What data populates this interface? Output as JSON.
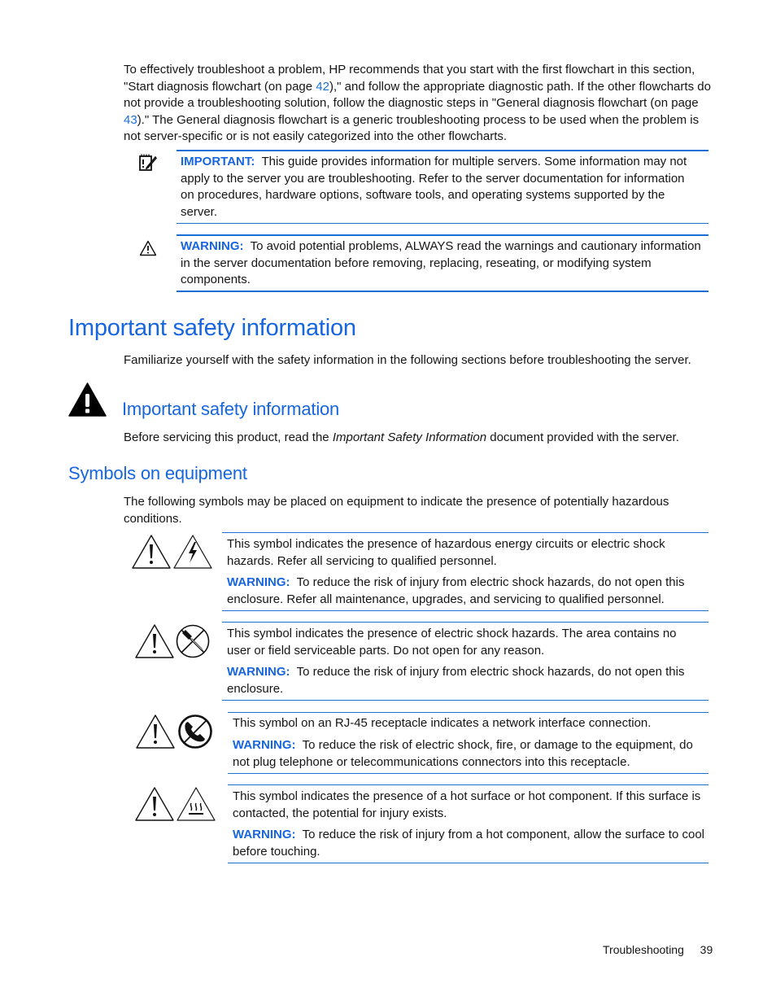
{
  "intro": {
    "text_1": "To effectively troubleshoot a problem, HP recommends that you start with the first flowchart in this section, \"Start diagnosis flowchart (on page ",
    "link_1": "42",
    "text_2": "),\" and follow the appropriate diagnostic path. If the other flowcharts do not provide a troubleshooting solution, follow the diagnostic steps in \"General diagnosis flowchart (on page ",
    "link_2": "43",
    "text_3": ").\" The General diagnosis flowchart is a generic troubleshooting process to be used when the problem is not server-specific or is not easily categorized into the other flowcharts."
  },
  "notes": [
    {
      "icon": "notepad-pencil-icon",
      "label": "IMPORTANT:",
      "text": "This guide provides information for multiple servers. Some information may not apply to the server you are troubleshooting. Refer to the server documentation for information on procedures, hardware options, software tools, and operating systems supported by the server."
    },
    {
      "icon": "warning-triangle-icon",
      "label": "WARNING:",
      "text": "To avoid potential problems, ALWAYS read the warnings and cautionary information in the server documentation before removing, replacing, reseating, or modifying system components."
    }
  ],
  "section": {
    "title": "Important safety information",
    "intro": "Familiarize yourself with the safety information in the following sections before troubleshooting the server."
  },
  "subsection_safety": {
    "icon": "solid-warning-triangle-icon",
    "title": "Important safety information",
    "text_before": "Before servicing this product, read the ",
    "text_italic": "Important Safety Information",
    "text_after": " document provided with the server."
  },
  "subsection_symbols": {
    "title": "Symbols on equipment",
    "intro": "The following symbols may be placed on equipment to indicate the presence of potentially hazardous conditions.",
    "items": [
      {
        "icons": [
          "exclamation-triangle-icon",
          "lightning-triangle-icon"
        ],
        "description": "This symbol indicates the presence of hazardous energy circuits or electric shock hazards. Refer all servicing to qualified personnel.",
        "warning_label": "WARNING:",
        "warning_text": "To reduce the risk of injury from electric shock hazards, do not open this enclosure. Refer all maintenance, upgrades, and servicing to qualified personnel."
      },
      {
        "icons": [
          "exclamation-triangle-icon",
          "no-screwdriver-icon"
        ],
        "description": "This symbol indicates the presence of electric shock hazards. The area contains no user or field serviceable parts. Do not open for any reason.",
        "warning_label": "WARNING:",
        "warning_text": "To reduce the risk of injury from electric shock hazards, do not open this enclosure."
      },
      {
        "icons": [
          "exclamation-triangle-icon",
          "no-telephone-icon"
        ],
        "description": "This symbol on an RJ-45 receptacle indicates a network interface connection.",
        "warning_label": "WARNING:",
        "warning_text": "To reduce the risk of electric shock, fire, or damage to the equipment, do not plug telephone or telecommunications connectors into this receptacle."
      },
      {
        "icons": [
          "exclamation-triangle-icon",
          "hot-surface-triangle-icon"
        ],
        "description": "This symbol indicates the presence of a hot surface or hot component. If this surface is contacted, the potential for injury exists.",
        "warning_label": "WARNING:",
        "warning_text": "To reduce the risk of injury from a hot component, allow the surface to cool before touching."
      }
    ]
  },
  "footer": {
    "chapter": "Troubleshooting",
    "page_number": "39"
  },
  "colors": {
    "accent_blue": "#1766e0",
    "text": "#151515"
  }
}
